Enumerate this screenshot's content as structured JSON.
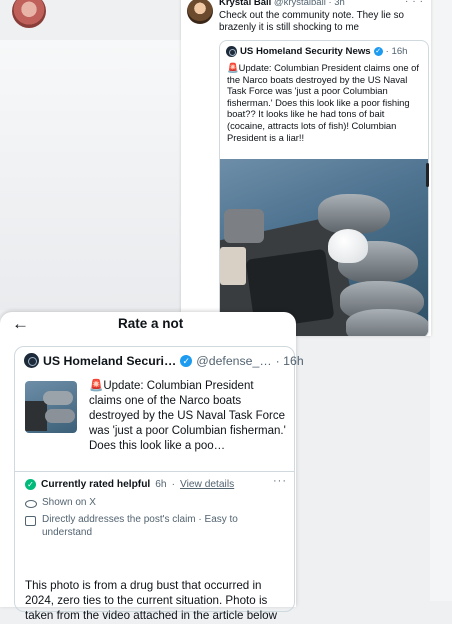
{
  "tweet": {
    "name": "Krystal Ball",
    "handle": "@krystalball",
    "time": "· 3h",
    "text": "Check out the community note. They lie so brazenly it is still shocking to me",
    "more_icon": "···",
    "quote": {
      "name": "US Homeland Security News",
      "time": "· 16h",
      "text": "🚨Update: Columbian President claims one of the Narco boats destroyed by the US Naval Task Force was 'just a poor Columbian fisherman.' Does this look like a poor fishing boat?? It looks like he had tons of bait (cocaine, attracts lots of fish)! Columbian President is a liar!!"
    }
  },
  "panel": {
    "back_icon": "←",
    "title": "Rate a not",
    "card": {
      "name": "US Homeland Securi…",
      "handle": "@defense_…",
      "time": "· 16h",
      "text": "🚨Update: Columbian President claims one of the Narco boats destroyed by the US Naval Task Force was 'just a poor Columbian fisherman.' Does this look like a poo…"
    },
    "rating": {
      "status": "Currently rated helpful",
      "time": "6h",
      "dot": "·",
      "link": "View details",
      "more": "···"
    },
    "shown_on": "Shown on X",
    "addresses": "Directly addresses the post's claim · Easy to understand",
    "note_text": "This photo is from a drug bust that occurred in 2024, zero ties to the current situation. Photo is taken from the video attached in the article below"
  }
}
